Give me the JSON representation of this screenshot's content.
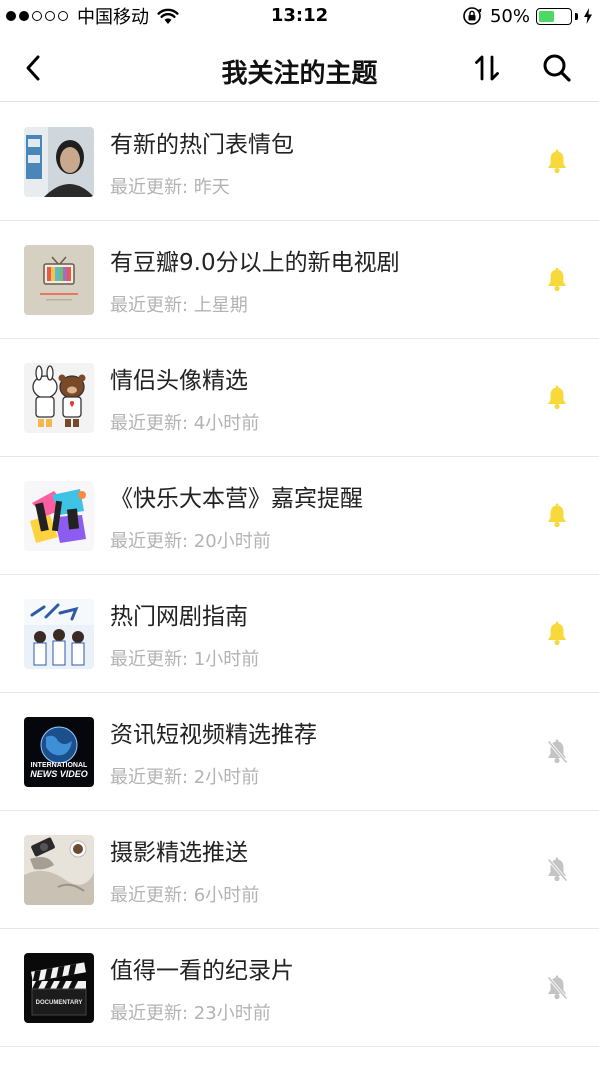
{
  "status_bar": {
    "carrier": "中国移动",
    "time": "13:12",
    "battery_percent": "50%",
    "battery_level": 0.5,
    "signal_bars_filled": 2,
    "signal_bars_total": 5
  },
  "nav": {
    "title": "我关注的主题",
    "back_icon": "chevron-left-icon",
    "sort_icon": "sort-icon",
    "search_icon": "search-icon"
  },
  "colors": {
    "bell_active": "#f8d93b",
    "bell_muted": "#c4c4c4",
    "battery": "#4cd964"
  },
  "topics": [
    {
      "title": "有新的热门表情包",
      "updated": "最近更新: 昨天",
      "notifications_on": true
    },
    {
      "title": "有豆瓣9.0分以上的新电视剧",
      "updated": "最近更新: 上星期",
      "notifications_on": true
    },
    {
      "title": "情侣头像精选",
      "updated": "最近更新: 4小时前",
      "notifications_on": true
    },
    {
      "title": "《快乐大本营》嘉宾提醒",
      "updated": "最近更新: 20小时前",
      "notifications_on": true
    },
    {
      "title": "热门网剧指南",
      "updated": "最近更新: 1小时前",
      "notifications_on": true
    },
    {
      "title": "资讯短视频精选推荐",
      "updated": "最近更新: 2小时前",
      "notifications_on": false
    },
    {
      "title": "摄影精选推送",
      "updated": "最近更新: 6小时前",
      "notifications_on": false
    },
    {
      "title": "值得一看的纪录片",
      "updated": "最近更新: 23小时前",
      "notifications_on": false
    }
  ],
  "thumbnail_texts": {
    "news_video": [
      "INTERNATIONAL",
      "NEWS VIDEO"
    ],
    "documentary": "DOCUMENTARY"
  }
}
